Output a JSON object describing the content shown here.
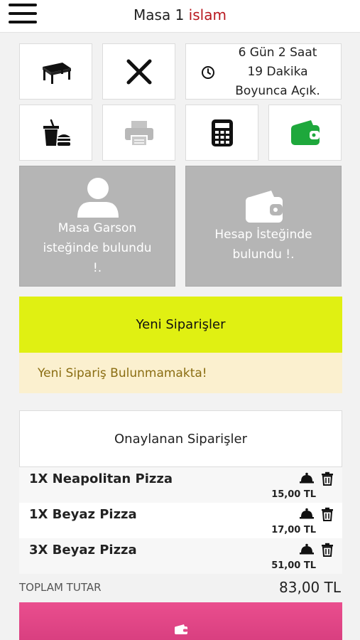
{
  "header": {
    "title": "Masa 1",
    "user": "islam"
  },
  "timer": {
    "line1": "6 Gün 2 Saat",
    "line2": "19 Dakika",
    "line3": "Boyunca Açık."
  },
  "icons": {
    "menu": "hamburger-menu-icon",
    "table": "table-icon",
    "close": "close-icon",
    "clock": "clock-icon",
    "food": "food-order-icon",
    "print": "printer-icon",
    "calculator": "calculator-icon",
    "wallet": "wallet-icon",
    "waiter": "user-icon",
    "bill": "wallet-icon",
    "serve": "serving-bell-icon",
    "delete": "trash-icon",
    "pay": "wallet-icon"
  },
  "colors": {
    "accent_red": "#b8181f",
    "new_orders_bg": "#e0f012",
    "notice_bg": "#fbf0cf",
    "wallet_green": "#1ea83c",
    "pay_pink": "#e04887"
  },
  "alerts": {
    "waiter_line1": "Masa Garson",
    "waiter_line2": "isteğinde bulundu",
    "waiter_line3": "!.",
    "bill_line1": "Hesap İsteğinde",
    "bill_line2": "bulundu !."
  },
  "new_orders": {
    "title": "Yeni Siparişler",
    "empty_message": "Yeni Sipariş Bulunmamakta!"
  },
  "approved": {
    "title": "Onaylanan Siparişler",
    "items": [
      {
        "name": "1X Neapolitan Pizza",
        "price": "15,00 TL"
      },
      {
        "name": "1X Beyaz Pizza",
        "price": "17,00 TL"
      },
      {
        "name": "3X Beyaz Pizza",
        "price": "51,00 TL"
      }
    ]
  },
  "total": {
    "label": "TOPLAM TUTAR",
    "value": "83,00 TL"
  }
}
